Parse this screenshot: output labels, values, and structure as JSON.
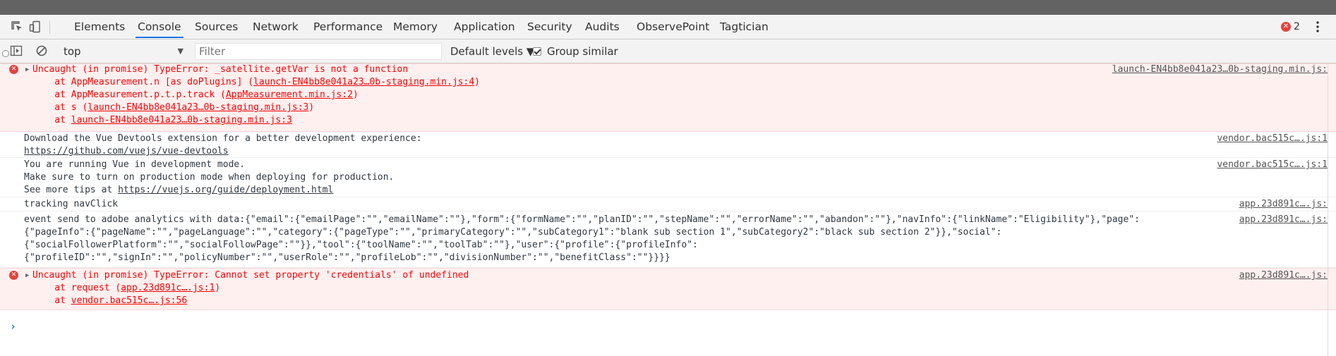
{
  "toolbar": {
    "tabs": [
      "Elements",
      "Console",
      "Sources",
      "Network",
      "Performance",
      "Memory",
      "Application",
      "Security",
      "Audits",
      "ObservePoint",
      "Tagtician"
    ],
    "active_tab": "Console",
    "error_count": "2"
  },
  "filterbar": {
    "context": "top",
    "filter_placeholder": "Filter",
    "levels_label": "Default levels ▼",
    "group_similar_label": "Group similar"
  },
  "messages": {
    "m1": {
      "text": "Uncaught (in promise) TypeError: _satellite.getVar is not a function",
      "source": "launch-EN4bb8e041a23…0b-staging.min.js:",
      "frames": [
        {
          "prefix": "    at AppMeasurement.n [as doPlugins] (",
          "link": "launch-EN4bb8e041a23…0b-staging.min.js:4",
          "suffix": ")"
        },
        {
          "prefix": "    at AppMeasurement.p.t.p.track (",
          "link": "AppMeasurement.min.js:2",
          "suffix": ")"
        },
        {
          "prefix": "    at s (",
          "link": "launch-EN4bb8e041a23…0b-staging.min.js:3",
          "suffix": ")"
        },
        {
          "prefix": "    at ",
          "link": "launch-EN4bb8e041a23…0b-staging.min.js:3",
          "suffix": ""
        }
      ]
    },
    "m2": {
      "line1": "Download the Vue Devtools extension for a better development experience:",
      "link": "https://github.com/vuejs/vue-devtools",
      "source": "vendor.bac515c….js:1"
    },
    "m3": {
      "line1": "You are running Vue in development mode.",
      "line2": "Make sure to turn on production mode when deploying for production.",
      "line3_prefix": "See more tips at ",
      "line3_link": "https://vuejs.org/guide/deployment.html",
      "source": "vendor.bac515c….js:1"
    },
    "m4": {
      "text": "tracking navClick",
      "source": "app.23d891c….js:"
    },
    "m5": {
      "lines": [
        "event send to adobe analytics with data:{\"email\":{\"emailPage\":\"\",\"emailName\":\"\"},\"form\":{\"formName\":\"\",\"planID\":\"\",\"stepName\":\"\",\"errorName\":\"\",\"abandon\":\"\"},\"navInfo\":{\"linkName\":\"Eligibility\"},\"page\":",
        "{\"pageInfo\":{\"pageName\":\"\",\"pageLanguage\":\"\",\"category\":{\"pageType\":\"\",\"primaryCategory\":\"\",\"subCategory1\":\"blank sub section 1\",\"subCategory2\":\"black sub section 2\"}},\"social\":",
        "{\"socialFollowerPlatform\":\"\",\"socialFollowPage\":\"\"}},\"tool\":{\"toolName\":\"\",\"toolTab\":\"\"},\"user\":{\"profile\":{\"profileInfo\":",
        "{\"profileID\":\"\",\"signIn\":\"\",\"policyNumber\":\"\",\"userRole\":\"\",\"profileLob\":\"\",\"divisionNumber\":\"\",\"benefitClass\":\"\"}}}}"
      ],
      "source": "app.23d891c….js:"
    },
    "m6": {
      "text": "Uncaught (in promise) TypeError: Cannot set property 'credentials' of undefined",
      "source": "app.23d891c….js:",
      "frames": [
        {
          "prefix": "    at request (",
          "link": "app.23d891c….js:1",
          "suffix": ")"
        },
        {
          "prefix": "    at ",
          "link": "vendor.bac515c….js:56",
          "suffix": ""
        }
      ]
    }
  },
  "prompt_symbol": "›",
  "icons": {
    "error": "error-x-icon",
    "inspect": "inspect-element-icon",
    "device": "device-toggle-icon",
    "sidebar": "console-sidebar-icon",
    "clear": "clear-console-icon",
    "more": "kebab-menu-icon"
  },
  "colors": {
    "error_text": "#ff0000",
    "error_bg": "#fff0f0",
    "active_tab": "#1a73e8",
    "error_icon": "#e0443e"
  }
}
